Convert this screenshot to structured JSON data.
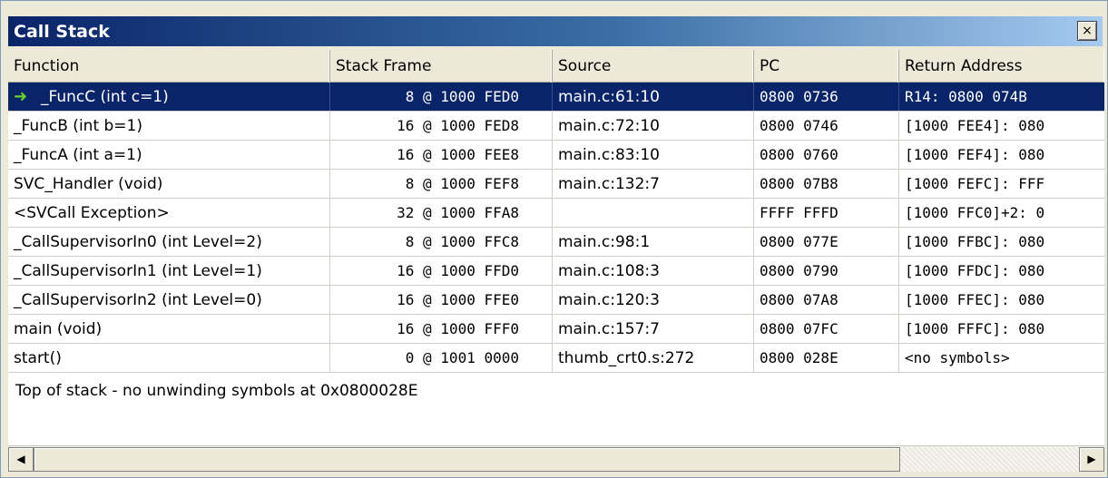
{
  "window": {
    "title": "Call Stack",
    "close_glyph": "×"
  },
  "columns": [
    "Function",
    "Stack Frame",
    "Source",
    "PC",
    "Return Address"
  ],
  "rows": [
    {
      "function": "_FuncC (int c=1)",
      "frame": "8 @ 1000 FED0",
      "source": "main.c:61:10",
      "pc": "0800 0736",
      "ret": "R14: 0800 074B",
      "selected": true
    },
    {
      "function": "_FuncB (int b=1)",
      "frame": "16 @ 1000 FED8",
      "source": "main.c:72:10",
      "pc": "0800 0746",
      "ret": "[1000 FEE4]: 080"
    },
    {
      "function": "_FuncA (int a=1)",
      "frame": "16 @ 1000 FEE8",
      "source": "main.c:83:10",
      "pc": "0800 0760",
      "ret": "[1000 FEF4]: 080"
    },
    {
      "function": "SVC_Handler (void)",
      "frame": "8 @ 1000 FEF8",
      "source": "main.c:132:7",
      "pc": "0800 07B8",
      "ret": "[1000 FEFC]: FFF"
    },
    {
      "function": "<SVCall Exception>",
      "frame": "32 @ 1000 FFA8",
      "source": "",
      "pc": "FFFF FFFD",
      "ret": "[1000 FFC0]+2: 0"
    },
    {
      "function": "_CallSupervisorIn0 (int Level=2)",
      "frame": "8 @ 1000 FFC8",
      "source": "main.c:98:1",
      "pc": "0800 077E",
      "ret": "[1000 FFBC]: 080"
    },
    {
      "function": "_CallSupervisorIn1 (int Level=1)",
      "frame": "16 @ 1000 FFD0",
      "source": "main.c:108:3",
      "pc": "0800 0790",
      "ret": "[1000 FFDC]: 080"
    },
    {
      "function": "_CallSupervisorIn2 (int Level=0)",
      "frame": "16 @ 1000 FFE0",
      "source": "main.c:120:3",
      "pc": "0800 07A8",
      "ret": "[1000 FFEC]: 080"
    },
    {
      "function": "main (void)",
      "frame": "16 @ 1000 FFF0",
      "source": "main.c:157:7",
      "pc": "0800 07FC",
      "ret": "[1000 FFFC]: 080"
    },
    {
      "function": "start()",
      "frame": "0 @ 1001 0000",
      "source": "thumb_crt0.s:272",
      "pc": "0800 028E",
      "ret": "<no symbols>"
    }
  ],
  "footer": "Top of stack - no unwinding symbols at 0x0800028E",
  "icons": {
    "current_frame": "green-arrow-right-icon",
    "scroll_left": "◀",
    "scroll_right": "▶"
  },
  "colors": {
    "selection": "#0a246a",
    "arrow": "#6bd12b"
  }
}
